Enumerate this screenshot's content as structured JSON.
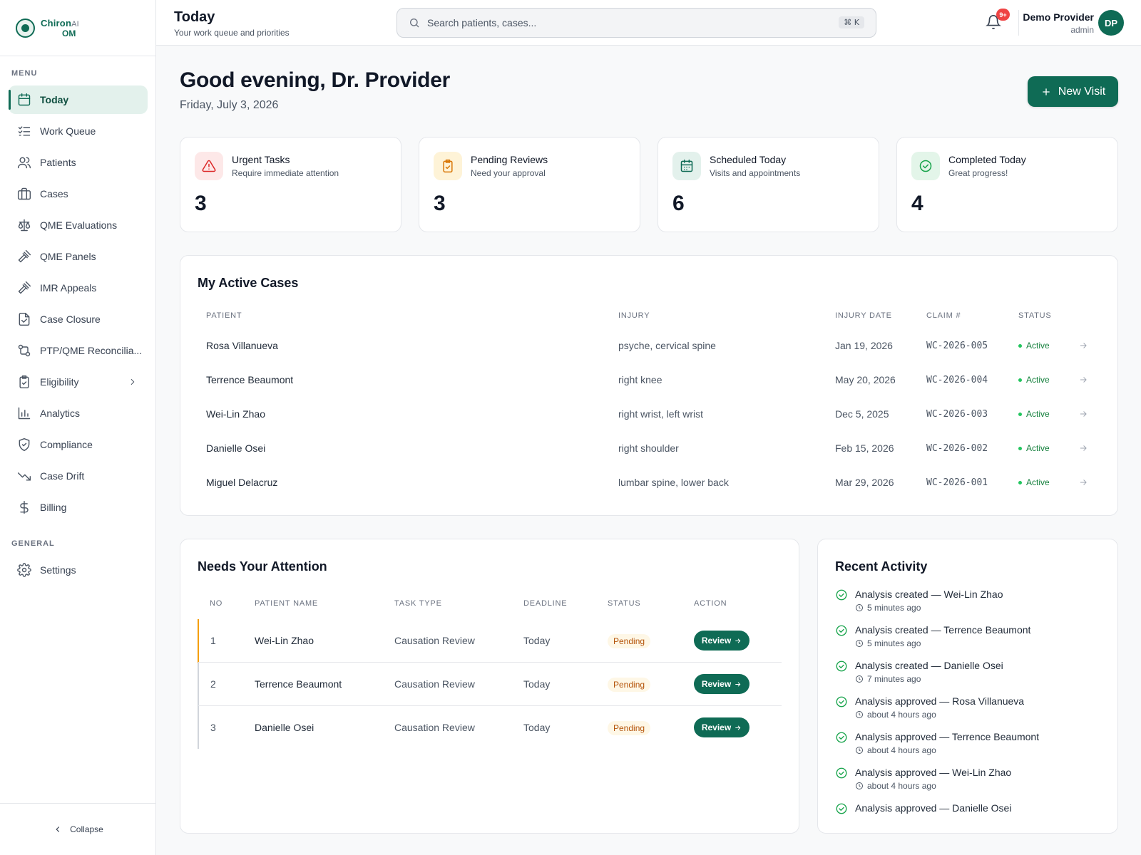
{
  "brand": {
    "line1": "Chiron",
    "line1_suffix": "AI",
    "line2": "OM"
  },
  "sidebar": {
    "menu_label": "MENU",
    "general_label": "GENERAL",
    "items": [
      {
        "label": "Today",
        "icon": "calendar-icon",
        "active": true
      },
      {
        "label": "Work Queue",
        "icon": "list-checks-icon"
      },
      {
        "label": "Patients",
        "icon": "users-icon"
      },
      {
        "label": "Cases",
        "icon": "briefcase-icon"
      },
      {
        "label": "QME Evaluations",
        "icon": "scale-icon"
      },
      {
        "label": "QME Panels",
        "icon": "gavel-icon"
      },
      {
        "label": "IMR Appeals",
        "icon": "gavel-icon"
      },
      {
        "label": "Case Closure",
        "icon": "file-closed-icon"
      },
      {
        "label": "PTP/QME Reconcilia...",
        "icon": "git-compare-icon"
      },
      {
        "label": "Eligibility",
        "icon": "clipboard-check-icon",
        "has_submenu": true
      },
      {
        "label": "Analytics",
        "icon": "bar-chart-icon"
      },
      {
        "label": "Compliance",
        "icon": "shield-check-icon"
      },
      {
        "label": "Case Drift",
        "icon": "trending-down-icon"
      },
      {
        "label": "Billing",
        "icon": "dollar-icon"
      }
    ],
    "general_items": [
      {
        "label": "Settings",
        "icon": "gear-icon"
      }
    ],
    "collapse_label": "Collapse"
  },
  "header": {
    "title": "Today",
    "subtitle": "Your work queue and priorities",
    "search_placeholder": "Search patients, cases...",
    "search_shortcut": "⌘ K",
    "notification_count": "9+",
    "user_name": "Demo Provider",
    "user_role": "admin",
    "user_initials": "DP"
  },
  "greeting": {
    "title": "Good evening, Dr. Provider",
    "date": "Friday, July 3, 2026",
    "new_visit_label": "New Visit"
  },
  "stats": [
    {
      "title": "Urgent Tasks",
      "subtitle": "Require immediate attention",
      "value": "3",
      "icon": "alert-triangle-icon",
      "color": "#dc2626",
      "bg": "#fde8e8"
    },
    {
      "title": "Pending Reviews",
      "subtitle": "Need your approval",
      "value": "3",
      "icon": "clipboard-check-icon",
      "color": "#d97706",
      "bg": "#fef3d7"
    },
    {
      "title": "Scheduled Today",
      "subtitle": "Visits and appointments",
      "value": "6",
      "icon": "calendar-icon",
      "color": "#0f6b55",
      "bg": "#e3f1ec"
    },
    {
      "title": "Completed Today",
      "subtitle": "Great progress!",
      "value": "4",
      "icon": "check-circle-icon",
      "color": "#16a34a",
      "bg": "#e3f5e9"
    }
  ],
  "active_cases": {
    "title": "My Active Cases",
    "columns": [
      "PATIENT",
      "INJURY",
      "INJURY DATE",
      "CLAIM #",
      "STATUS"
    ],
    "rows": [
      {
        "patient": "Rosa Villanueva",
        "injury": "psyche, cervical spine",
        "date": "Jan 19, 2026",
        "claim": "WC-2026-005",
        "status": "Active"
      },
      {
        "patient": "Terrence Beaumont",
        "injury": "right knee",
        "date": "May 20, 2026",
        "claim": "WC-2026-004",
        "status": "Active"
      },
      {
        "patient": "Wei-Lin Zhao",
        "injury": "right wrist, left wrist",
        "date": "Dec 5, 2025",
        "claim": "WC-2026-003",
        "status": "Active"
      },
      {
        "patient": "Danielle Osei",
        "injury": "right shoulder",
        "date": "Feb 15, 2026",
        "claim": "WC-2026-002",
        "status": "Active"
      },
      {
        "patient": "Miguel Delacruz",
        "injury": "lumbar spine, lower back",
        "date": "Mar 29, 2026",
        "claim": "WC-2026-001",
        "status": "Active"
      }
    ]
  },
  "attention": {
    "title": "Needs Your Attention",
    "columns": [
      "NO",
      "PATIENT NAME",
      "TASK TYPE",
      "DEADLINE",
      "STATUS",
      "ACTION"
    ],
    "rows": [
      {
        "no": "1",
        "patient": "Wei-Lin Zhao",
        "task": "Causation Review",
        "deadline": "Today",
        "status": "Pending",
        "action": "Review"
      },
      {
        "no": "2",
        "patient": "Terrence Beaumont",
        "task": "Causation Review",
        "deadline": "Today",
        "status": "Pending",
        "action": "Review"
      },
      {
        "no": "3",
        "patient": "Danielle Osei",
        "task": "Causation Review",
        "deadline": "Today",
        "status": "Pending",
        "action": "Review"
      }
    ]
  },
  "activity": {
    "title": "Recent Activity",
    "items": [
      {
        "text": "Analysis created — Wei-Lin Zhao",
        "time": "5 minutes ago"
      },
      {
        "text": "Analysis created — Terrence Beaumont",
        "time": "5 minutes ago"
      },
      {
        "text": "Analysis created — Danielle Osei",
        "time": "7 minutes ago"
      },
      {
        "text": "Analysis approved — Rosa Villanueva",
        "time": "about 4 hours ago"
      },
      {
        "text": "Analysis approved — Terrence Beaumont",
        "time": "about 4 hours ago"
      },
      {
        "text": "Analysis approved — Wei-Lin Zhao",
        "time": "about 4 hours ago"
      },
      {
        "text": "Analysis approved — Danielle Osei",
        "time": ""
      }
    ]
  }
}
